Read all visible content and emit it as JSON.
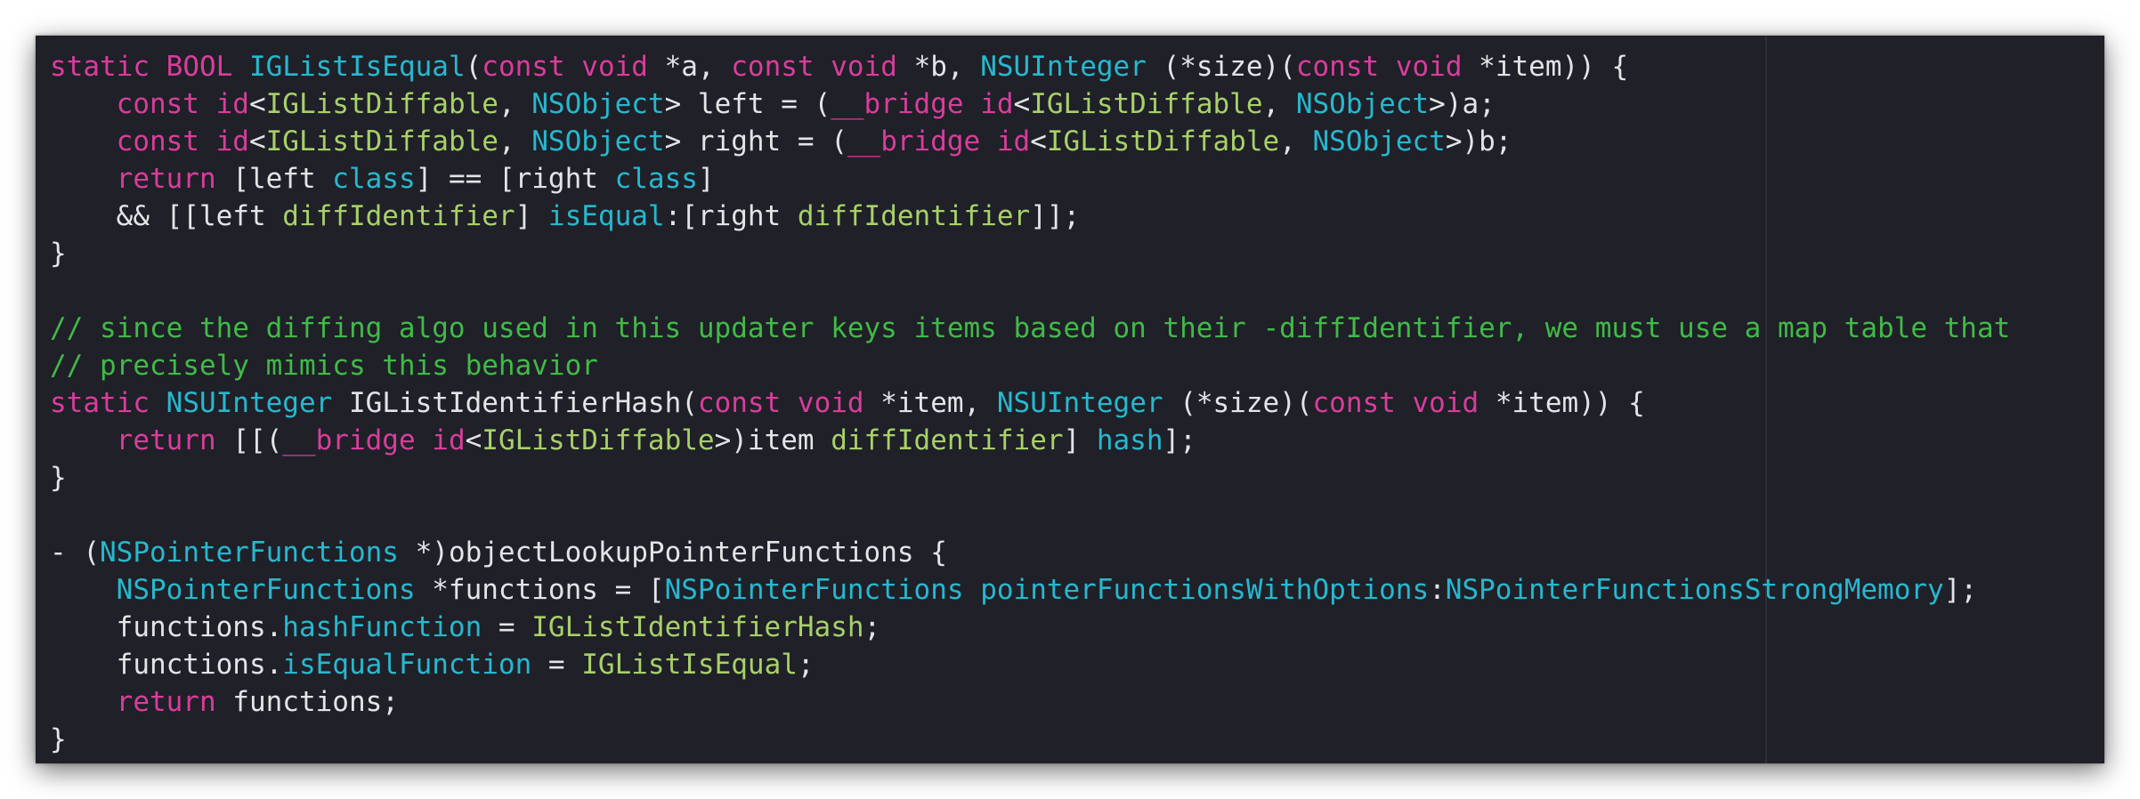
{
  "editor": {
    "language": "Objective-C",
    "theme_colors": {
      "background": "#1f2028",
      "plain": "#e3e4e6",
      "keyword": "#d93d9b",
      "type": "#27b8cf",
      "function": "#a8d069",
      "comment": "#41ba47"
    },
    "lines": [
      [
        [
          "kw",
          "static "
        ],
        [
          "kw",
          "BOOL "
        ],
        [
          "ty",
          "IGListIsEqual"
        ],
        [
          "pl",
          "("
        ],
        [
          "kw",
          "const "
        ],
        [
          "kw",
          "void "
        ],
        [
          "pl",
          "*a, "
        ],
        [
          "kw",
          "const "
        ],
        [
          "kw",
          "void "
        ],
        [
          "pl",
          "*b, "
        ],
        [
          "ty",
          "NSUInteger"
        ],
        [
          "pl",
          " (*size)("
        ],
        [
          "kw",
          "const "
        ],
        [
          "kw",
          "void "
        ],
        [
          "pl",
          "*item)) {"
        ]
      ],
      [
        [
          "pl",
          "    "
        ],
        [
          "kw",
          "const "
        ],
        [
          "kw",
          "id"
        ],
        [
          "pl",
          "<"
        ],
        [
          "fn",
          "IGListDiffable"
        ],
        [
          "pl",
          ", "
        ],
        [
          "ty",
          "NSObject"
        ],
        [
          "pl",
          "> left = ("
        ],
        [
          "kw",
          "__bridge "
        ],
        [
          "kw",
          "id"
        ],
        [
          "pl",
          "<"
        ],
        [
          "fn",
          "IGListDiffable"
        ],
        [
          "pl",
          ", "
        ],
        [
          "ty",
          "NSObject"
        ],
        [
          "pl",
          ">)a;"
        ]
      ],
      [
        [
          "pl",
          "    "
        ],
        [
          "kw",
          "const "
        ],
        [
          "kw",
          "id"
        ],
        [
          "pl",
          "<"
        ],
        [
          "fn",
          "IGListDiffable"
        ],
        [
          "pl",
          ", "
        ],
        [
          "ty",
          "NSObject"
        ],
        [
          "pl",
          "> right = ("
        ],
        [
          "kw",
          "__bridge "
        ],
        [
          "kw",
          "id"
        ],
        [
          "pl",
          "<"
        ],
        [
          "fn",
          "IGListDiffable"
        ],
        [
          "pl",
          ", "
        ],
        [
          "ty",
          "NSObject"
        ],
        [
          "pl",
          ">)b;"
        ]
      ],
      [
        [
          "pl",
          "    "
        ],
        [
          "kw",
          "return"
        ],
        [
          "pl",
          " [left "
        ],
        [
          "ty",
          "class"
        ],
        [
          "pl",
          "] == [right "
        ],
        [
          "ty",
          "class"
        ],
        [
          "pl",
          "]"
        ]
      ],
      [
        [
          "pl",
          "    && [[left "
        ],
        [
          "fn",
          "diffIdentifier"
        ],
        [
          "pl",
          "] "
        ],
        [
          "ty",
          "isEqual"
        ],
        [
          "pl",
          ":[right "
        ],
        [
          "fn",
          "diffIdentifier"
        ],
        [
          "pl",
          "]];"
        ]
      ],
      [
        [
          "pl",
          "}"
        ]
      ],
      [],
      [
        [
          "cm",
          "// since the diffing algo used in this updater keys items based on their -diffIdentifier, we must use a map table that"
        ]
      ],
      [
        [
          "cm",
          "// precisely mimics this behavior"
        ]
      ],
      [
        [
          "kw",
          "static "
        ],
        [
          "ty",
          "NSUInteger "
        ],
        [
          "nt",
          "IGListIdentifierHash"
        ],
        [
          "pl",
          "("
        ],
        [
          "kw",
          "const "
        ],
        [
          "kw",
          "void "
        ],
        [
          "pl",
          "*item, "
        ],
        [
          "ty",
          "NSUInteger"
        ],
        [
          "pl",
          " (*size)("
        ],
        [
          "kw",
          "const "
        ],
        [
          "kw",
          "void "
        ],
        [
          "pl",
          "*item)) {"
        ]
      ],
      [
        [
          "pl",
          "    "
        ],
        [
          "kw",
          "return"
        ],
        [
          "pl",
          " [[("
        ],
        [
          "kw",
          "__bridge "
        ],
        [
          "kw",
          "id"
        ],
        [
          "pl",
          "<"
        ],
        [
          "fn",
          "IGListDiffable"
        ],
        [
          "pl",
          ">)item "
        ],
        [
          "fn",
          "diffIdentifier"
        ],
        [
          "pl",
          "] "
        ],
        [
          "ty",
          "hash"
        ],
        [
          "pl",
          "];"
        ]
      ],
      [
        [
          "pl",
          "}"
        ]
      ],
      [],
      [
        [
          "pl",
          "- ("
        ],
        [
          "ty",
          "NSPointerFunctions"
        ],
        [
          "pl",
          " *)objectLookupPointerFunctions {"
        ]
      ],
      [
        [
          "pl",
          "    "
        ],
        [
          "ty",
          "NSPointerFunctions"
        ],
        [
          "pl",
          " *functions = ["
        ],
        [
          "ty",
          "NSPointerFunctions"
        ],
        [
          "pl",
          " "
        ],
        [
          "ty",
          "pointerFunctionsWithOptions"
        ],
        [
          "pl",
          ":"
        ],
        [
          "ty",
          "NSPointerFunctionsStrongMemory"
        ],
        [
          "pl",
          "];"
        ]
      ],
      [
        [
          "pl",
          "    functions."
        ],
        [
          "ty",
          "hashFunction"
        ],
        [
          "pl",
          " = "
        ],
        [
          "fn",
          "IGListIdentifierHash"
        ],
        [
          "pl",
          ";"
        ]
      ],
      [
        [
          "pl",
          "    functions."
        ],
        [
          "ty",
          "isEqualFunction"
        ],
        [
          "pl",
          " = "
        ],
        [
          "fn",
          "IGListIsEqual"
        ],
        [
          "pl",
          ";"
        ]
      ],
      [
        [
          "pl",
          "    "
        ],
        [
          "kw",
          "return"
        ],
        [
          "pl",
          " functions;"
        ]
      ],
      [
        [
          "pl",
          "}"
        ]
      ]
    ]
  }
}
